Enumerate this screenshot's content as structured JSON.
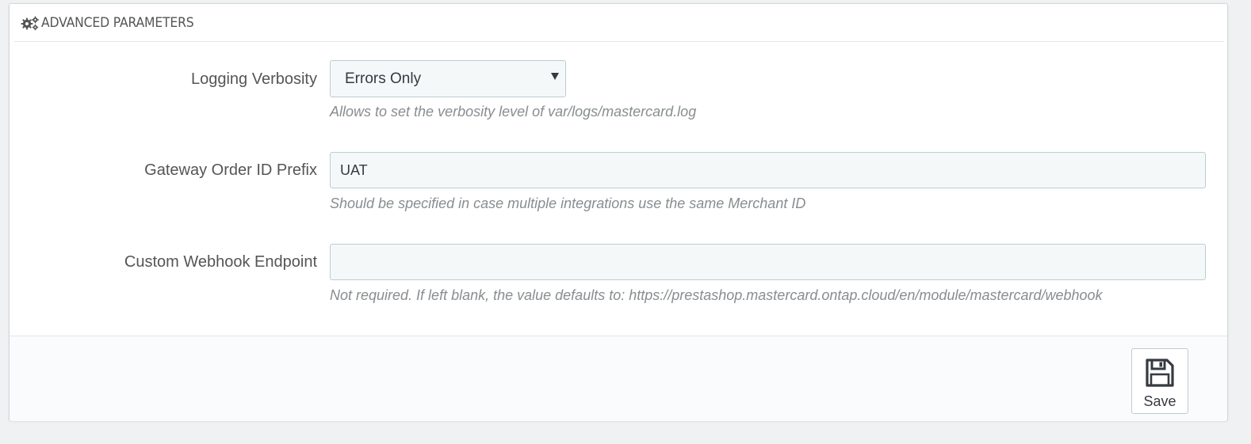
{
  "panel": {
    "title": "ADVANCED PARAMETERS",
    "title_icon": "cogs-icon"
  },
  "fields": {
    "logging": {
      "label": "Logging Verbosity",
      "selected": "Errors Only",
      "help": "Allows to set the verbosity level of var/logs/mastercard.log"
    },
    "order_prefix": {
      "label": "Gateway Order ID Prefix",
      "value": "UAT",
      "help": "Should be specified in case multiple integrations use the same Merchant ID"
    },
    "webhook": {
      "label": "Custom Webhook Endpoint",
      "value": "",
      "help": "Not required. If left blank, the value defaults to: https://prestashop.mastercard.ontap.cloud/en/module/mastercard/webhook"
    }
  },
  "footer": {
    "save_label": "Save",
    "save_icon": "floppy-disk-icon"
  }
}
